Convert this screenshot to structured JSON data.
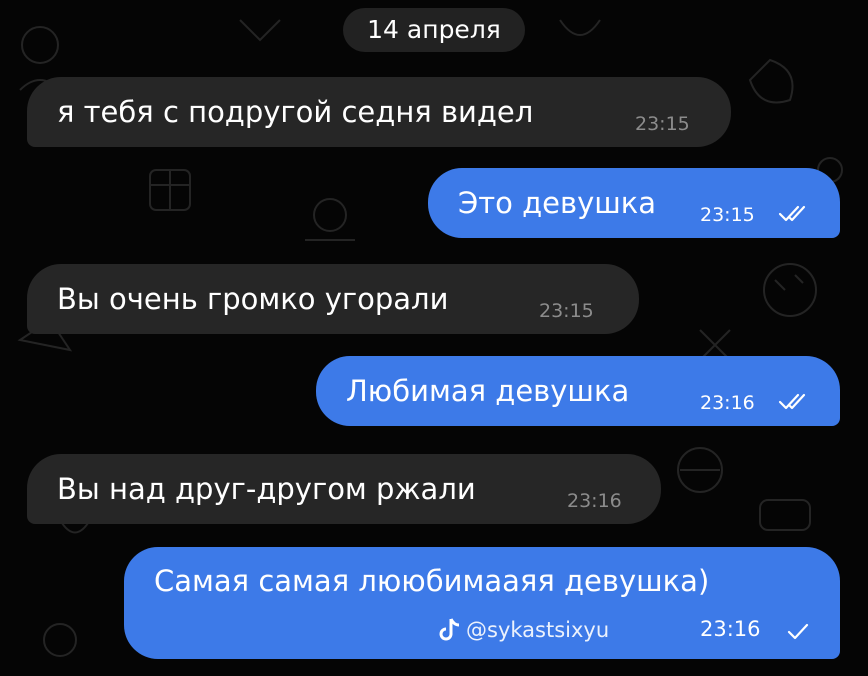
{
  "chat": {
    "date_label": "14 апреля",
    "messages": [
      {
        "text": "я тебя с подругой седня видел",
        "time": "23:15",
        "direction": "incoming"
      },
      {
        "text": "Это девушка",
        "time": "23:15",
        "direction": "outgoing",
        "status": "read"
      },
      {
        "text": "Вы очень громко угорали",
        "time": "23:15",
        "direction": "incoming"
      },
      {
        "text": "Любимая девушка",
        "time": "23:16",
        "direction": "outgoing",
        "status": "read"
      },
      {
        "text": "Вы над друг-другом ржали",
        "time": "23:16",
        "direction": "incoming"
      },
      {
        "text": "Самая самая лююбимааяя девушка)",
        "time": "23:16",
        "direction": "outgoing",
        "status": "sent"
      }
    ]
  },
  "watermark": {
    "icon": "tiktok-icon",
    "handle": "@sykastsixyu"
  },
  "colors": {
    "background": "#050505",
    "incoming_bubble": "#262626",
    "outgoing_bubble": "#3d7ae8",
    "date_pill": "#222222",
    "incoming_time": "#8c8c8c"
  }
}
